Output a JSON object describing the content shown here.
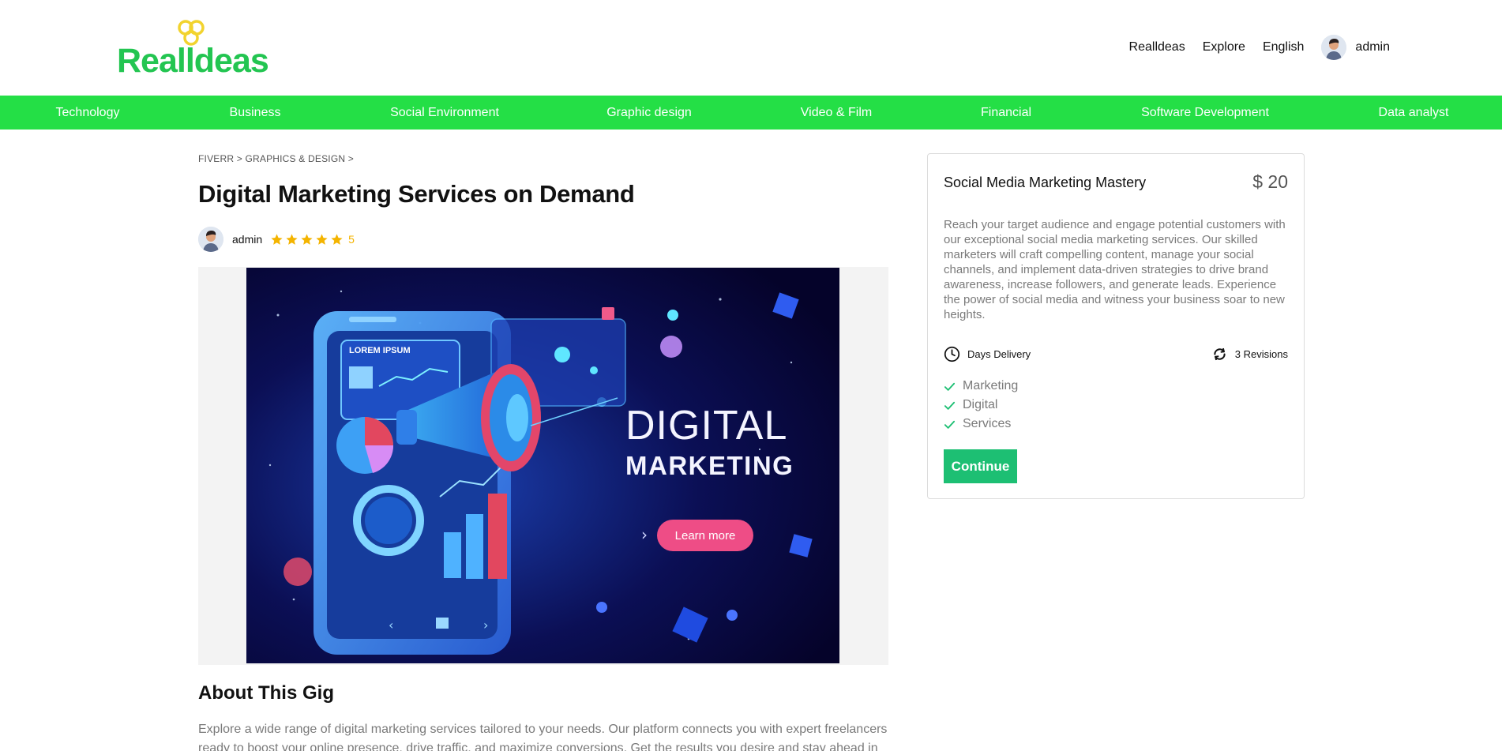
{
  "brand": {
    "name": "Realldeas",
    "color": "#23c551",
    "accent": "#f2d32e"
  },
  "top_nav": {
    "items": [
      "Realldeas",
      "Explore",
      "English"
    ],
    "user": "admin"
  },
  "categories": [
    "Technology",
    "Business",
    "Social Environment",
    "Graphic design",
    "Video & Film",
    "Financial",
    "Software Development",
    "Data analyst"
  ],
  "category_bar_color": "#24df46",
  "breadcrumb": "FIVERR > GRAPHICS & DESIGN >",
  "gig": {
    "title": "Digital Marketing Services on Demand",
    "seller": "admin",
    "stars": 5,
    "rating": "5",
    "image_text": {
      "screen_label": "LOREM IPSUM",
      "headline_1": "DIGITAL",
      "headline_2": "MARKETING",
      "cta": "Learn more"
    }
  },
  "about": {
    "title": "About This Gig",
    "text": "Explore a wide range of digital marketing services tailored to your needs. Our platform connects you with expert freelancers ready to boost your online presence, drive traffic, and maximize conversions. Get the results you desire and stay ahead in the"
  },
  "package": {
    "title": "Social Media Marketing Mastery",
    "price": "$ 20",
    "description": "Reach your target audience and engage potential customers with our exceptional social media marketing services. Our skilled marketers will craft compelling content, manage your social channels, and implement data-driven strategies to drive brand awareness, increase followers, and generate leads. Experience the power of social media and witness your business soar to new heights.",
    "delivery": "Days Delivery",
    "revisions": "3 Revisions",
    "features": [
      "Marketing",
      "Digital",
      "Services"
    ],
    "button": "Continue",
    "button_color": "#1dbf73"
  },
  "icons": {
    "clock": "clock-icon",
    "revisions": "refresh-icon",
    "check": "check-icon",
    "star": "star-icon"
  }
}
